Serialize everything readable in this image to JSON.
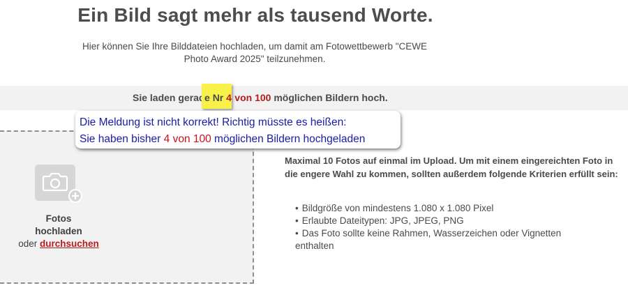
{
  "header": {
    "title": "Ein Bild sagt mehr als tausend Worte.",
    "intro_line1": "Hier können Sie Ihre Bilddateien hochladen, um damit am Fotowettbewerb \"CEWE",
    "intro_line2": "Photo Award 2025\" teilzunehmen."
  },
  "counter": {
    "prefix": "Sie laden gerad",
    "prefix_tail": "e ",
    "nr_label": "Nr ",
    "current": "4",
    "of_text": " von 100",
    "suffix": " möglichen Bildern hoch."
  },
  "annotation": {
    "line1": "Die Meldung ist nicht korrekt!  Richtig müsste es heißen:",
    "line2_prefix": "Sie haben bisher ",
    "line2_highlight": "4 von 100",
    "line2_suffix": " möglichen Bildern hochgeladen",
    "highlight_color": "#f7f14a"
  },
  "upload": {
    "icon": "camera-plus-icon",
    "label_line1": "Fotos",
    "label_line2": "hochladen",
    "or_text": "oder ",
    "browse_link": "durchsuchen"
  },
  "requirements": {
    "intro": "Maximal 10 Fotos auf einmal im Upload. Um mit einem eingereichten Foto in die engere Wahl zu kommen, sollten außerdem folgende Kriterien erfüllt sein:",
    "items": [
      "Bildgröße von mindestens 1.080 x 1.080 Pixel",
      "Erlaubte Dateitypen: JPG, JPEG, PNG",
      "Das Foto sollte keine Rahmen, Wasserzeichen oder Vignetten enthalten"
    ]
  },
  "colors": {
    "accent_red": "#b71c1c",
    "annotation_blue": "#1a1aa6",
    "band_gray": "#f2f2f2"
  }
}
